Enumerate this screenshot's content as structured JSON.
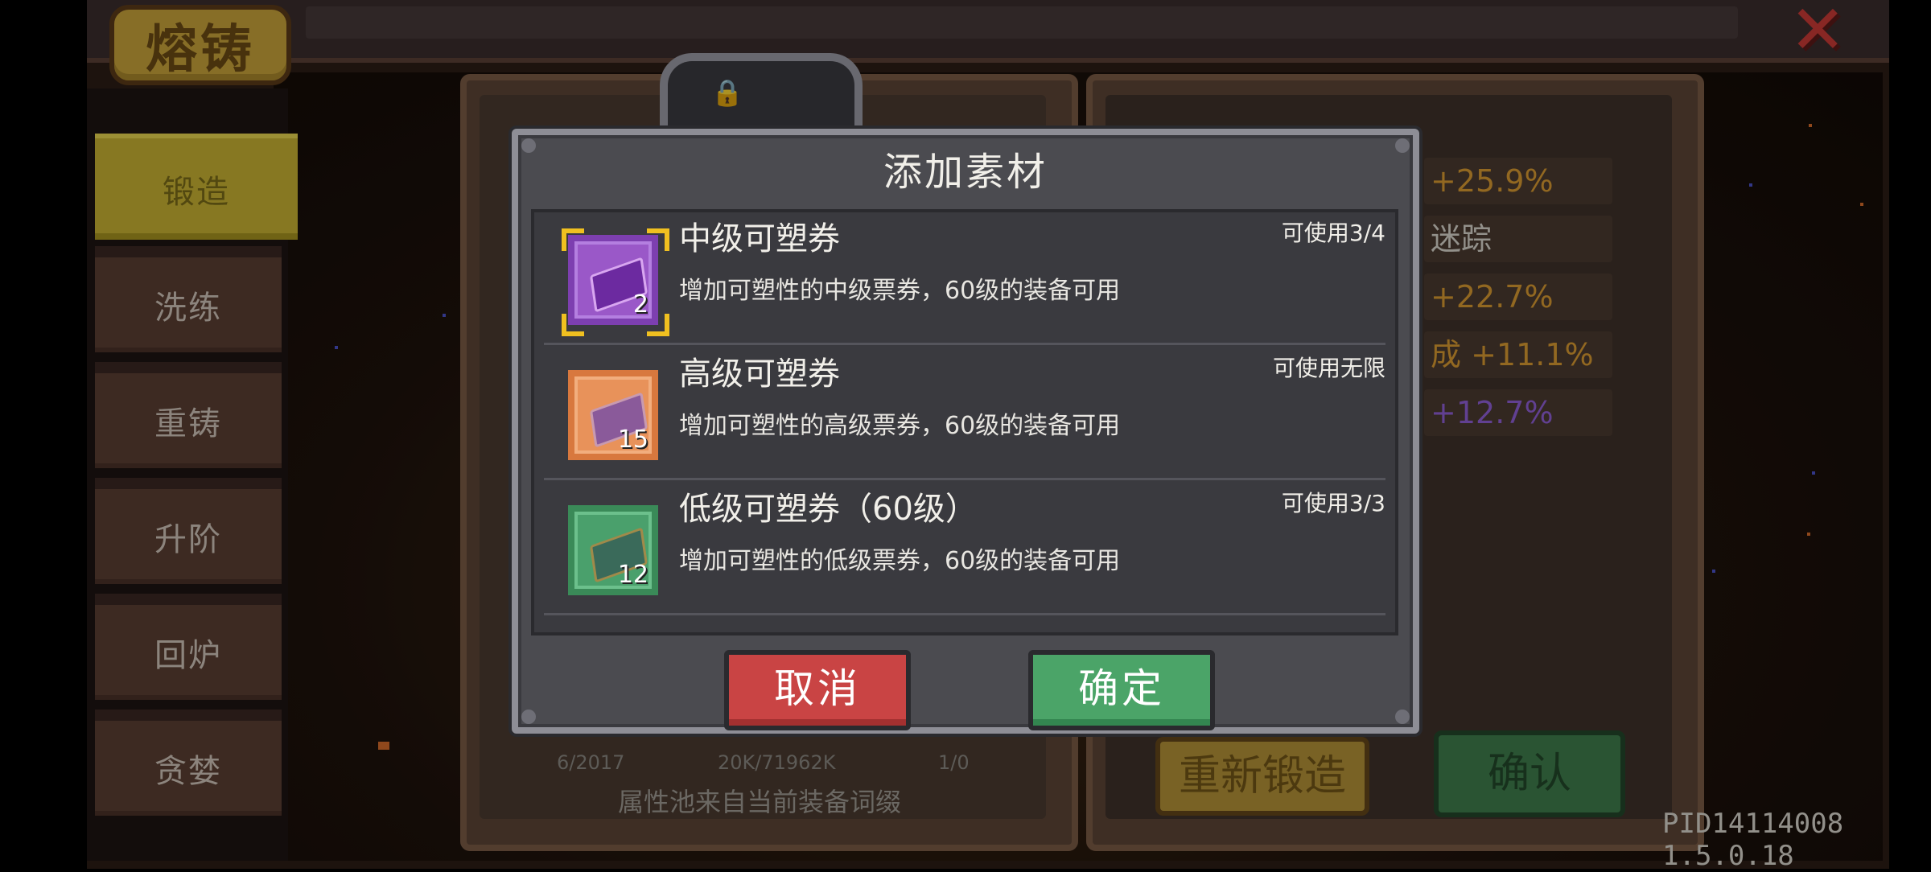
{
  "header": {
    "title": "熔铸"
  },
  "sidebar": {
    "items": [
      {
        "label": "锻造"
      },
      {
        "label": "洗练"
      },
      {
        "label": "重铸"
      },
      {
        "label": "升阶"
      },
      {
        "label": "回炉"
      },
      {
        "label": "贪婪"
      }
    ],
    "active_index": 0
  },
  "background": {
    "stats": [
      "+25.9%",
      "迷踪",
      "+22.7%",
      "成 +11.1%",
      "+12.7%"
    ],
    "footer_counts": [
      "6/2017",
      "20K/71962K",
      "1/0"
    ],
    "footer_note": "属性池来自当前装备词缀",
    "reforge_label": "重新锻造",
    "confirm_label": "确认"
  },
  "modal": {
    "title": "添加素材",
    "items": [
      {
        "name": "中级可塑券",
        "desc": "增加可塑性的中级票券，60级的装备可用",
        "usage": "可使用3/4",
        "count": "2",
        "color": "purple",
        "selected": true
      },
      {
        "name": "高级可塑券",
        "desc": "增加可塑性的高级票券，60级的装备可用",
        "usage": "可使用无限",
        "count": "15",
        "color": "orange",
        "selected": false
      },
      {
        "name": "低级可塑券（60级）",
        "desc": "增加可塑性的低级票券，60级的装备可用",
        "usage": "可使用3/3",
        "count": "12",
        "color": "green",
        "selected": false
      }
    ],
    "cancel_label": "取消",
    "confirm_label": "确定"
  },
  "version": "PID14114008 1.5.0.18",
  "colors": {
    "accent_yellow": "#c8b233",
    "cancel_red": "#c94444",
    "confirm_green": "#4ba468",
    "modal_gray": "#4b4b50"
  }
}
